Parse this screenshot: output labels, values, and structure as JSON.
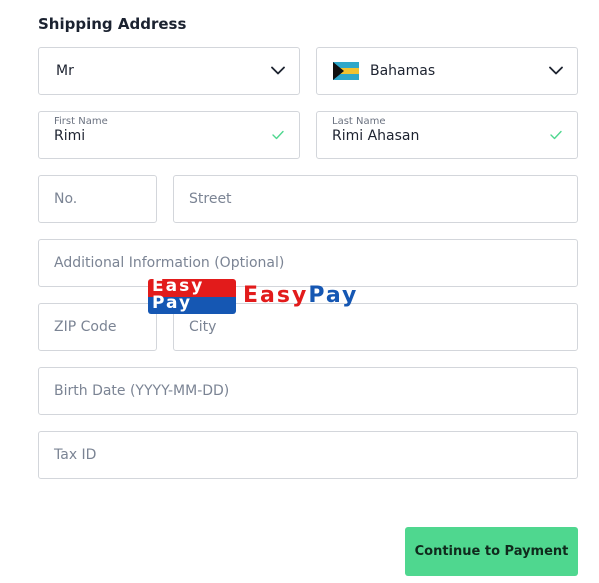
{
  "form": {
    "title": "Shipping Address",
    "salutation": {
      "value": "Mr"
    },
    "country": {
      "value": "Bahamas",
      "flag_icon": "bahamas-flag-icon"
    },
    "first_name": {
      "label": "First Name",
      "value": "Rimi",
      "valid": true
    },
    "last_name": {
      "label": "Last Name",
      "value": "Rimi Ahasan",
      "valid": true
    },
    "house_number": {
      "placeholder": "No."
    },
    "street": {
      "placeholder": "Street"
    },
    "additional_info": {
      "placeholder": "Additional Information (Optional)"
    },
    "zip_code": {
      "placeholder": "ZIP Code"
    },
    "city": {
      "placeholder": "City"
    },
    "birth_date": {
      "placeholder": "Birth Date (YYYY-MM-DD)"
    },
    "tax_id": {
      "placeholder": "Tax ID"
    },
    "submit_label": "Continue to Payment"
  },
  "watermark": {
    "badge_word_1": "Easy",
    "badge_word_2": "Pay",
    "text_part_1": "Easy",
    "text_part_2": "Pay"
  },
  "colors": {
    "accent_button": "#4fd78f",
    "valid_check": "#4fd78f",
    "border": "#d3d6db",
    "watermark_red": "#e21b1b",
    "watermark_blue": "#1557b3"
  }
}
